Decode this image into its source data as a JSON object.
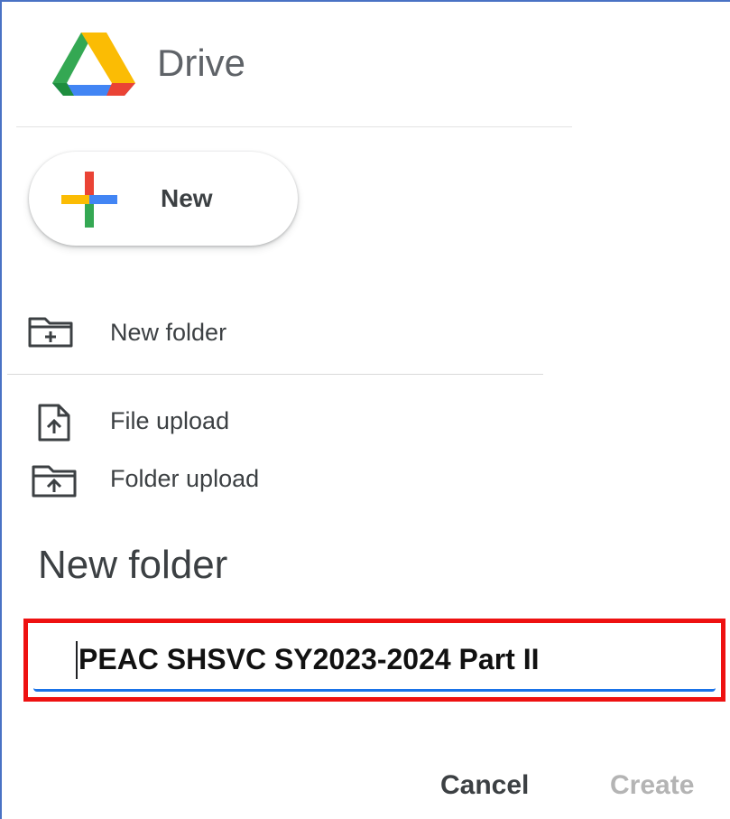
{
  "app": {
    "brand": "Drive"
  },
  "sidebar": {
    "new_button_label": "New",
    "menu": [
      {
        "label": "New folder",
        "icon": "new-folder-icon"
      },
      {
        "label": "File upload",
        "icon": "file-upload-icon"
      },
      {
        "label": "Folder upload",
        "icon": "folder-upload-icon"
      }
    ]
  },
  "dialog": {
    "title": "New folder",
    "input_value": "PEAC SHSVC SY2023-2024 Part II",
    "cancel_label": "Cancel",
    "create_label": "Create"
  },
  "colors": {
    "google_blue": "#4285f4",
    "google_red": "#ea4335",
    "google_yellow": "#fbbc04",
    "google_green": "#34a853",
    "highlight_border": "#ee1111",
    "focus_underline": "#1a73e8",
    "disabled_text": "#b4b4b4"
  }
}
